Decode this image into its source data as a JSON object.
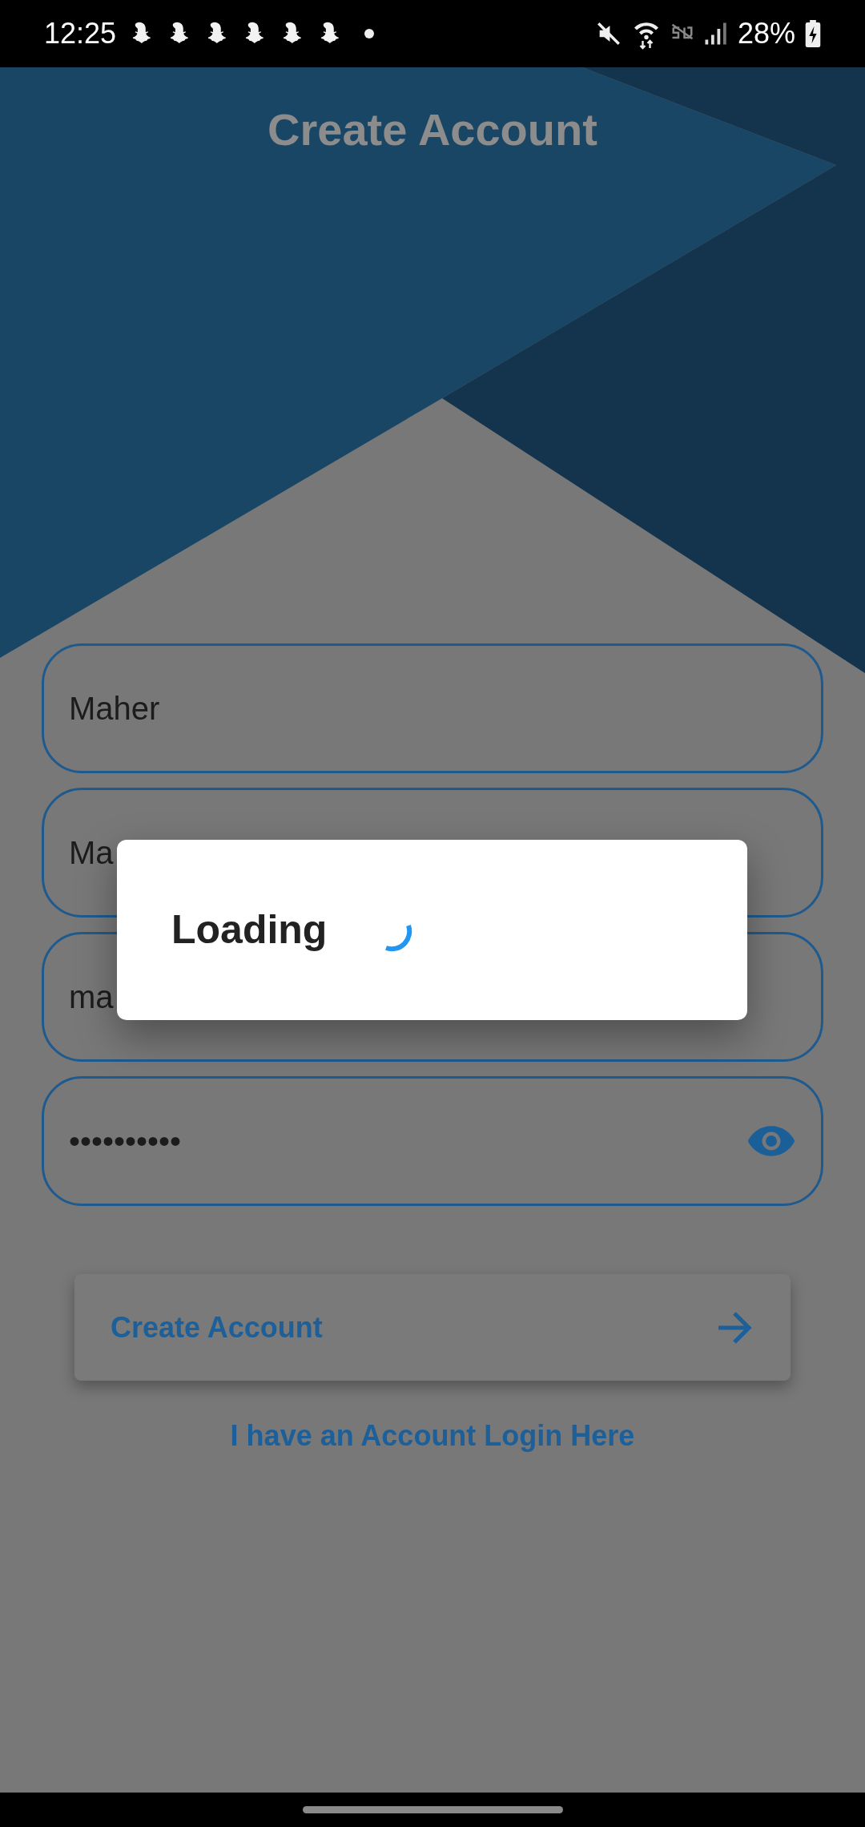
{
  "status_bar": {
    "time": "12:25",
    "battery": "28%"
  },
  "header": {
    "title": "Create Account"
  },
  "fields": [
    {
      "kind": "text",
      "value": "Maher"
    },
    {
      "kind": "text",
      "value": "Ma"
    },
    {
      "kind": "text",
      "value": "ma"
    },
    {
      "kind": "password",
      "value": "••••••••••"
    }
  ],
  "primary_button": {
    "label": "Create Account"
  },
  "login_link": {
    "label": "I have an Account Login Here"
  },
  "dialog": {
    "message": "Loading"
  }
}
